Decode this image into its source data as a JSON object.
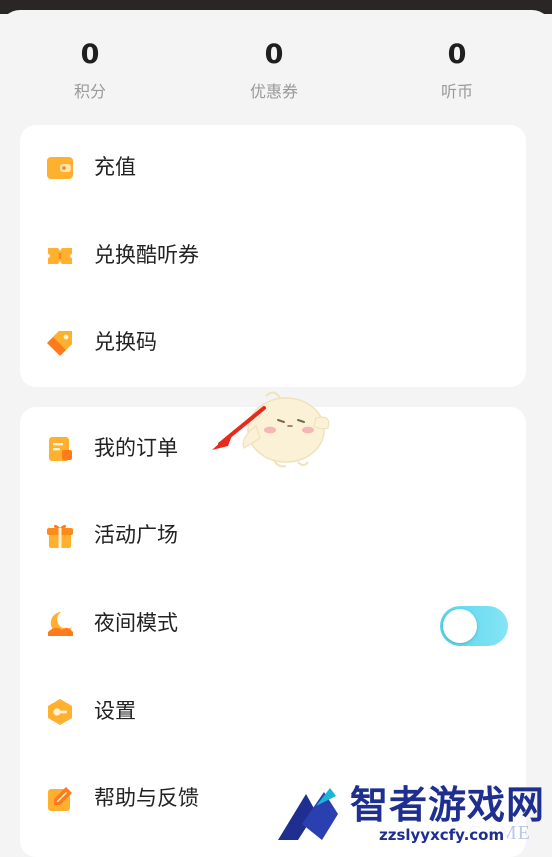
{
  "stats": [
    {
      "value": "0",
      "label": "积分"
    },
    {
      "value": "0",
      "label": "优惠券"
    },
    {
      "value": "0",
      "label": "听币"
    }
  ],
  "menu_group_1": [
    {
      "label": "充值",
      "icon": "wallet-icon"
    },
    {
      "label": "兑换酷听券",
      "icon": "ticket-icon"
    },
    {
      "label": "兑换码",
      "icon": "tag-icon"
    }
  ],
  "menu_group_2": [
    {
      "label": "我的订单",
      "icon": "order-icon"
    },
    {
      "label": "活动广场",
      "icon": "gift-icon"
    },
    {
      "label": "夜间模式",
      "icon": "moon-icon",
      "toggle_on": true
    },
    {
      "label": "设置",
      "icon": "gear-hex-icon"
    },
    {
      "label": "帮助与反馈",
      "icon": "edit-note-icon"
    }
  ],
  "watermark": {
    "title": "智者游戏网",
    "url": "zzslyyxcfy.com",
    "overlay": "GAME"
  },
  "colors": {
    "accent_orange": "#ffb02e",
    "toggle_cyan": "#58d6ef",
    "watermark_blue": "#1e2f8f"
  }
}
